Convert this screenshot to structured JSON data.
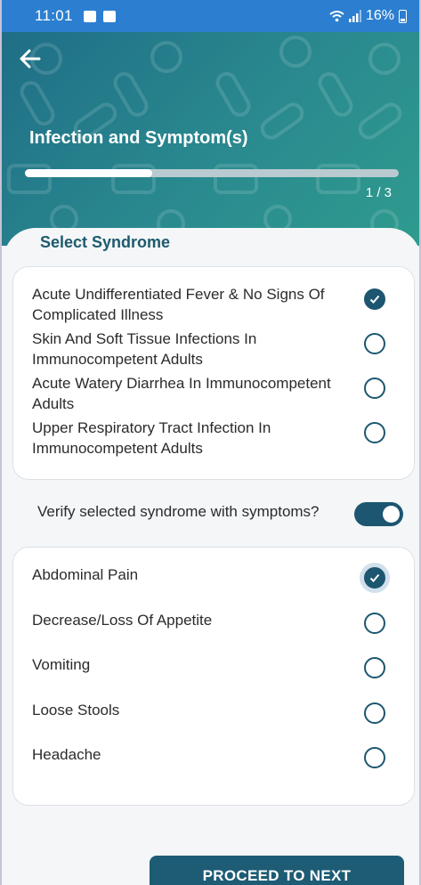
{
  "status_bar": {
    "time": "11:01",
    "battery": "16%"
  },
  "header": {
    "title": "Infection and Symptom(s)",
    "progress_text": "1 / 3",
    "progress_fraction": 0.34
  },
  "syndrome_section": {
    "title": "Select Syndrome",
    "items": [
      {
        "label": "Acute Undifferentiated Fever & No Signs Of Complicated Illness",
        "checked": true
      },
      {
        "label": "Skin And Soft Tissue Infections In Immunocompetent Adults",
        "checked": false
      },
      {
        "label": "Acute Watery Diarrhea In Immunocompetent Adults",
        "checked": false
      },
      {
        "label": "Upper Respiratory Tract Infection In Immunocompetent Adults",
        "checked": false
      }
    ]
  },
  "verify": {
    "label": "Verify selected syndrome with symptoms?",
    "enabled": true
  },
  "symptoms": {
    "items": [
      {
        "label": "Abdominal Pain",
        "checked": true
      },
      {
        "label": "Decrease/Loss Of Appetite",
        "checked": false
      },
      {
        "label": "Vomiting",
        "checked": false
      },
      {
        "label": "Loose Stools",
        "checked": false
      },
      {
        "label": "Headache",
        "checked": false
      }
    ]
  },
  "footer": {
    "proceed_label": "PROCEED TO NEXT"
  },
  "colors": {
    "status_bar": "#2c7fd0",
    "accent": "#1c5670",
    "section_title": "#1e5a6d"
  }
}
